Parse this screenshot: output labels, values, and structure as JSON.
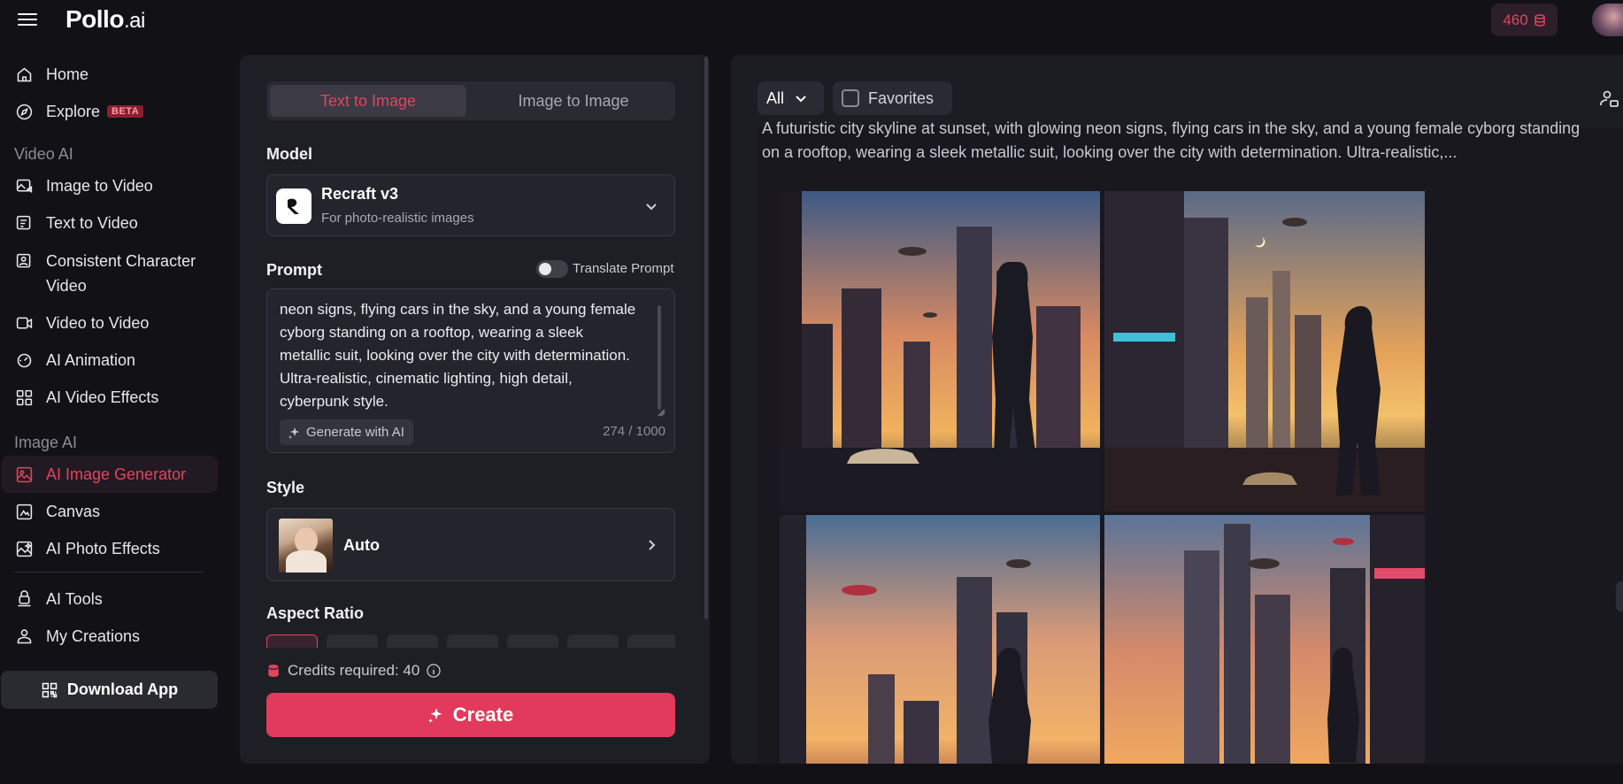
{
  "header": {
    "brand": "Pollo",
    "brand_suffix": ".ai",
    "credits": "460",
    "icons": {
      "menu": "hamburger-icon",
      "credits": "coin-stack-icon",
      "avatar": "user-avatar"
    }
  },
  "sidebar": {
    "items_top": [
      {
        "label": "Home",
        "icon": "home-icon"
      },
      {
        "label": "Explore",
        "icon": "compass-icon",
        "badge": "BETA"
      }
    ],
    "video_section": {
      "label": "Video AI",
      "items": [
        {
          "label": "Image to Video",
          "icon": "image-video-icon"
        },
        {
          "label": "Text to Video",
          "icon": "text-video-icon"
        },
        {
          "label": "Consistent Character Video",
          "icon": "character-video-icon"
        },
        {
          "label": "Video to Video",
          "icon": "video-video-icon"
        },
        {
          "label": "AI Animation",
          "icon": "animation-icon"
        },
        {
          "label": "AI Video Effects",
          "icon": "effects-grid-icon"
        }
      ]
    },
    "image_section": {
      "label": "Image AI",
      "items": [
        {
          "label": "AI Image Generator",
          "icon": "image-generator-icon",
          "active": true
        },
        {
          "label": "Canvas",
          "icon": "canvas-icon"
        },
        {
          "label": "AI Photo Effects",
          "icon": "photo-effects-icon"
        }
      ]
    },
    "items_bottom": [
      {
        "label": "AI Tools",
        "icon": "tools-icon"
      },
      {
        "label": "My Creations",
        "icon": "creations-icon"
      }
    ],
    "download_label": "Download App"
  },
  "form": {
    "tabs": [
      {
        "label": "Text to Image",
        "active": true
      },
      {
        "label": "Image to Image",
        "active": false
      }
    ],
    "model_label": "Model",
    "model": {
      "name": "Recraft v3",
      "description": "For photo-realistic images"
    },
    "prompt_label": "Prompt",
    "translate_label": "Translate Prompt",
    "translate_enabled": false,
    "prompt_value": "A futuristic city skyline at sunset, with glowing neon signs, flying cars in the sky, and a young female cyborg standing on a rooftop, wearing a sleek metallic suit, looking over the city with determination. Ultra-realistic, cinematic lighting, high detail, cyberpunk style.",
    "prompt_visible": "neon signs, flying cars in the sky, and a young female cyborg standing on a rooftop, wearing a sleek metallic suit, looking over the city with determination. Ultra-realistic, cinematic lighting, high detail, cyberpunk style.",
    "generate_ai_label": "Generate with AI",
    "char_count": "274 / 1000",
    "style_label": "Style",
    "style_value": "Auto",
    "aspect_label": "Aspect Ratio",
    "credits_required": "Credits required: 40",
    "create_label": "Create"
  },
  "results": {
    "filter": "All",
    "favorites_label": "Favorites",
    "prompt_display": "A futuristic city skyline at sunset, with glowing neon signs, flying cars in the sky, and a young female cyborg standing on a rooftop, wearing a sleek metallic suit, looking over the city with determination. Ultra-realistic,...",
    "images": [
      "generated-image-1",
      "generated-image-2",
      "generated-image-3",
      "generated-image-4"
    ]
  },
  "colors": {
    "accent": "#e2445f",
    "background": "#121116",
    "panel": "#1e1e25",
    "text": "#e9e9ee",
    "muted": "#8d8c95"
  }
}
